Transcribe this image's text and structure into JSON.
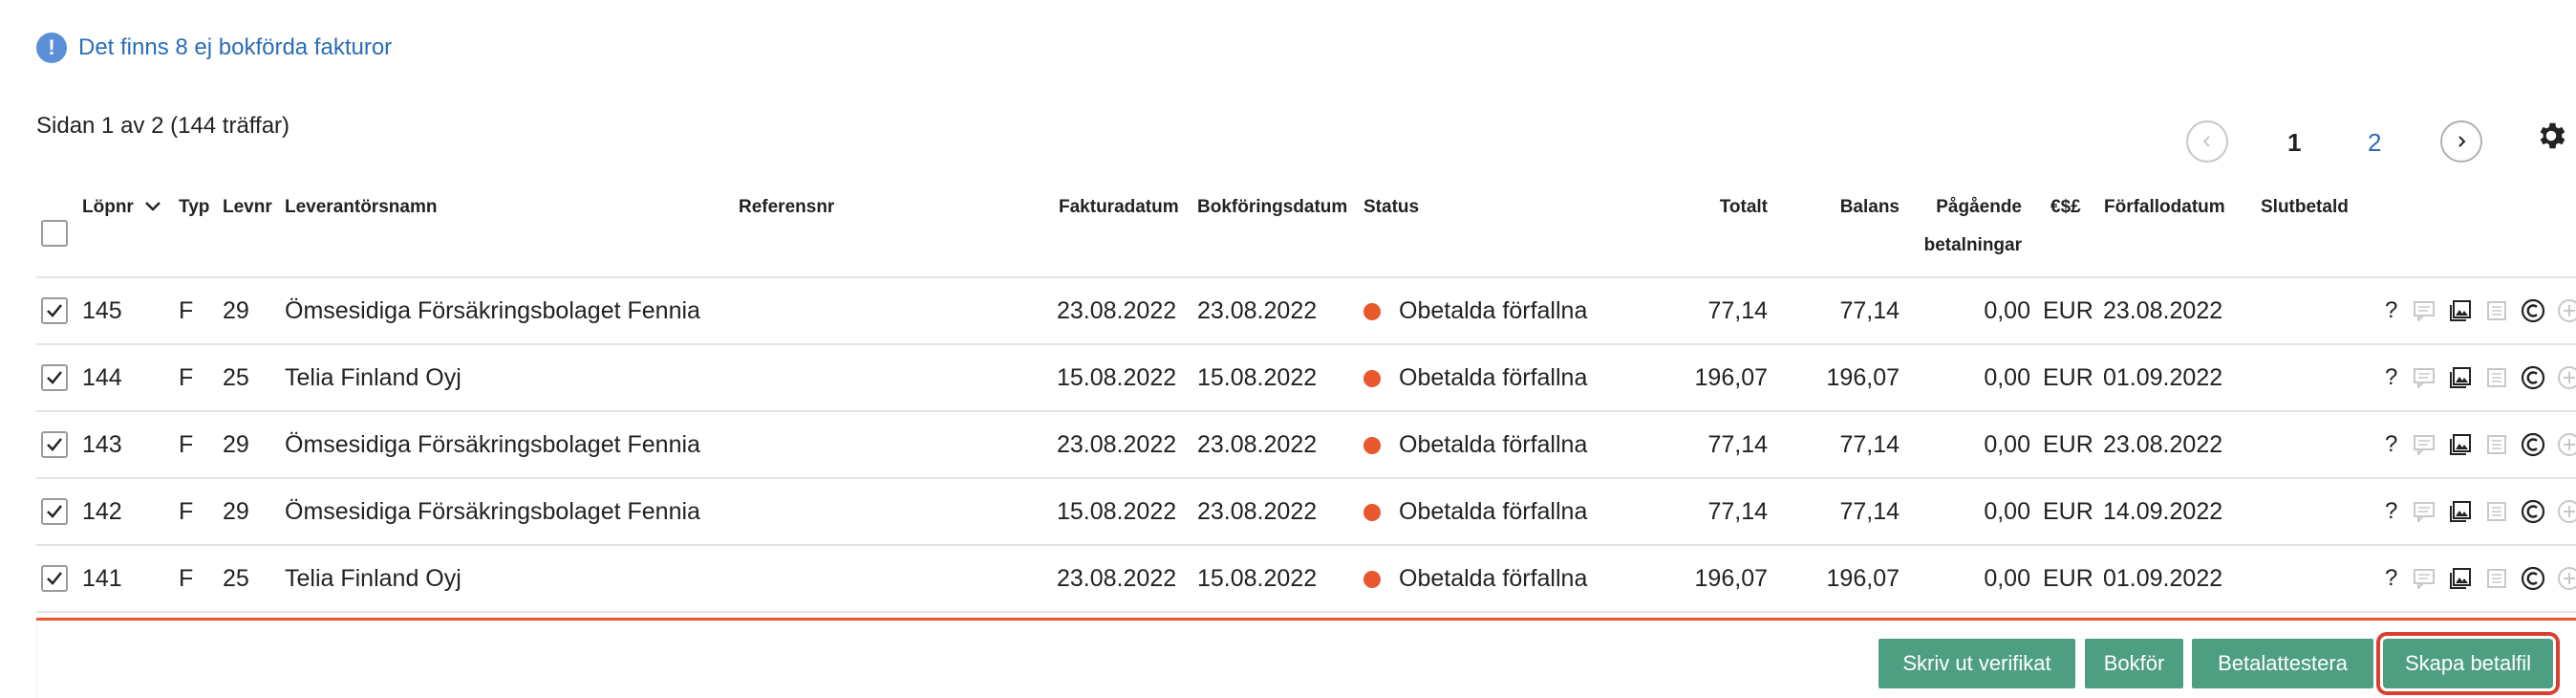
{
  "notice": {
    "icon": "exclamation-icon",
    "text": "Det finns 8 ej bokförda fakturor"
  },
  "page_info": "Sidan 1 av 2  (144 träffar)",
  "pagination": {
    "prev_icon": "chevron-left-icon",
    "pages": [
      "1",
      "2"
    ],
    "current": "1",
    "next_icon": "chevron-right-icon"
  },
  "table": {
    "headers": {
      "lopnr": "Löpnr",
      "typ": "Typ",
      "levnr": "Levnr",
      "leverantor": "Leverantörsnamn",
      "referens": "Referensnr",
      "fakturadatum": "Fakturadatum",
      "bokforingsdatum": "Bokföringsdatum",
      "status": "Status",
      "totalt": "Totalt",
      "balans": "Balans",
      "pagaende1": "Pågående",
      "pagaende2": "betalningar",
      "valuta": "€$£",
      "forfallodatum": "Förfallodatum",
      "slutbetald": "Slutbetald"
    },
    "rows": [
      {
        "lopnr": "145",
        "typ": "F",
        "levnr": "29",
        "leverantor": "Ömsesidiga Försäkringsbolaget Fennia",
        "fakturadatum": "23.08.2022",
        "bokforingsdatum": "23.08.2022",
        "status": "Obetalda förfallna",
        "totalt": "77,14",
        "balans": "77,14",
        "pagaende": "0,00",
        "valuta": "EUR",
        "forfallodatum": "23.08.2022",
        "action_q": "?"
      },
      {
        "lopnr": "144",
        "typ": "F",
        "levnr": "25",
        "leverantor": "Telia Finland Oyj",
        "fakturadatum": "15.08.2022",
        "bokforingsdatum": "15.08.2022",
        "status": "Obetalda förfallna",
        "totalt": "196,07",
        "balans": "196,07",
        "pagaende": "0,00",
        "valuta": "EUR",
        "forfallodatum": "01.09.2022",
        "action_q": "?"
      },
      {
        "lopnr": "143",
        "typ": "F",
        "levnr": "29",
        "leverantor": "Ömsesidiga Försäkringsbolaget Fennia",
        "fakturadatum": "23.08.2022",
        "bokforingsdatum": "23.08.2022",
        "status": "Obetalda förfallna",
        "totalt": "77,14",
        "balans": "77,14",
        "pagaende": "0,00",
        "valuta": "EUR",
        "forfallodatum": "23.08.2022",
        "action_q": "?"
      },
      {
        "lopnr": "142",
        "typ": "F",
        "levnr": "29",
        "leverantor": "Ömsesidiga Försäkringsbolaget Fennia",
        "fakturadatum": "15.08.2022",
        "bokforingsdatum": "23.08.2022",
        "status": "Obetalda förfallna",
        "totalt": "77,14",
        "balans": "77,14",
        "pagaende": "0,00",
        "valuta": "EUR",
        "forfallodatum": "14.09.2022",
        "action_q": "?"
      },
      {
        "lopnr": "141",
        "typ": "F",
        "levnr": "25",
        "leverantor": "Telia Finland Oyj",
        "fakturadatum": "23.08.2022",
        "bokforingsdatum": "15.08.2022",
        "status": "Obetalda förfallna",
        "totalt": "196,07",
        "balans": "196,07",
        "pagaende": "0,00",
        "valuta": "EUR",
        "forfallodatum": "01.09.2022",
        "action_q": "?"
      }
    ]
  },
  "status_color": "#e8582c",
  "buttons": {
    "print": "Skriv ut verifikat",
    "book": "Bokför",
    "approve": "Betalattestera",
    "create_file": "Skapa betalfil"
  },
  "colors": {
    "primary_button": "#4e9e82",
    "highlight": "#d9412f",
    "link": "#2b6cb8"
  }
}
